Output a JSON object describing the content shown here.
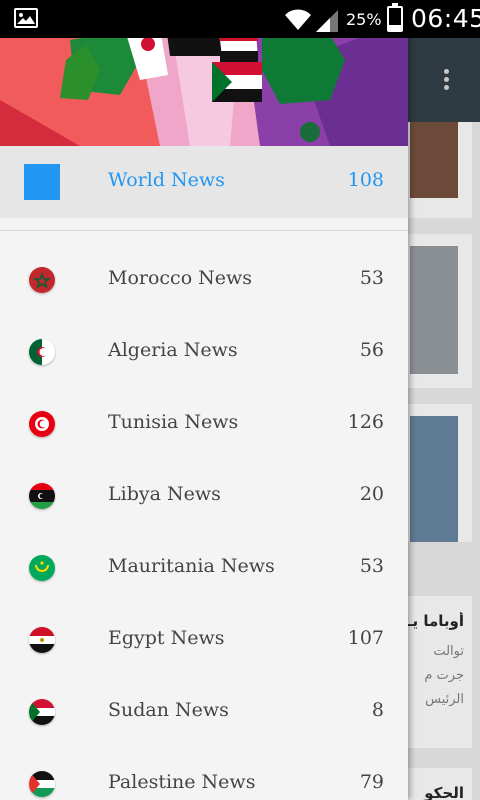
{
  "status_bar": {
    "battery_percent": "25%",
    "battery_level": 0.25,
    "time": "06:45"
  },
  "drawer": {
    "header": {
      "description": "flags"
    },
    "selected_item": {
      "label": "World News",
      "count": "108",
      "icon": "blue-square-icon",
      "color": "#2196f3"
    },
    "items": [
      {
        "label": "Morocco News",
        "count": "53",
        "icon": "morocco-flag-icon"
      },
      {
        "label": "Algeria News",
        "count": "56",
        "icon": "algeria-flag-icon"
      },
      {
        "label": "Tunisia News",
        "count": "126",
        "icon": "tunisia-flag-icon"
      },
      {
        "label": "Libya News",
        "count": "20",
        "icon": "libya-flag-icon"
      },
      {
        "label": "Mauritania News",
        "count": "53",
        "icon": "mauritania-flag-icon"
      },
      {
        "label": "Egypt News",
        "count": "107",
        "icon": "egypt-flag-icon"
      },
      {
        "label": "Sudan News",
        "count": "8",
        "icon": "sudan-flag-icon"
      },
      {
        "label": "Palestine News",
        "count": "79",
        "icon": "palestine-flag-icon"
      }
    ]
  },
  "background": {
    "toolbar_color": "#2f3b42",
    "article_headline": "أوباما يـ",
    "article_lines": [
      "توالت",
      "جرت م",
      "الرئيس"
    ],
    "article_headline_2": "الحكو"
  }
}
